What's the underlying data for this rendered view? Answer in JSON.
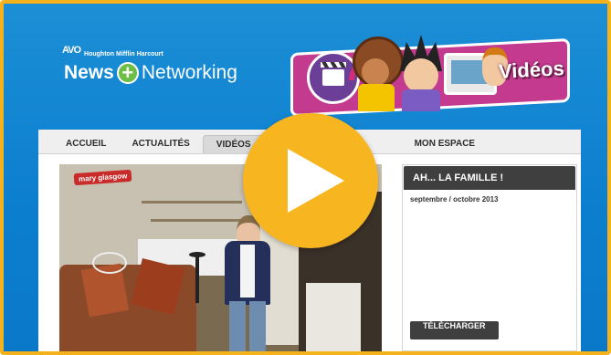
{
  "header": {
    "publisher_mark": "AVO",
    "publisher_name": "Houghton Mifflin Harcourt",
    "brand_left": "News",
    "brand_plus": "+",
    "brand_right": "Networking",
    "banner_title": "Vidéos"
  },
  "nav": {
    "tabs": [
      {
        "label": "ACCUEIL"
      },
      {
        "label": "ACTUALITÉS"
      },
      {
        "label": "VIDÉOS",
        "active": true
      },
      {
        "label": "MON ESPACE"
      }
    ]
  },
  "video": {
    "channel_logo": "mary glasgow",
    "play_icon": "play-icon"
  },
  "sidebar": {
    "title": "AH... LA FAMILLE !",
    "date": "septembre / octobre 2013",
    "download_label": "TÉLÉCHARGER"
  },
  "colors": {
    "frame": "#f4b31c",
    "background": "#1584d0",
    "play_button": "#f7b520",
    "banner": "#c43a8e",
    "dark_header": "#3f3f3f"
  }
}
